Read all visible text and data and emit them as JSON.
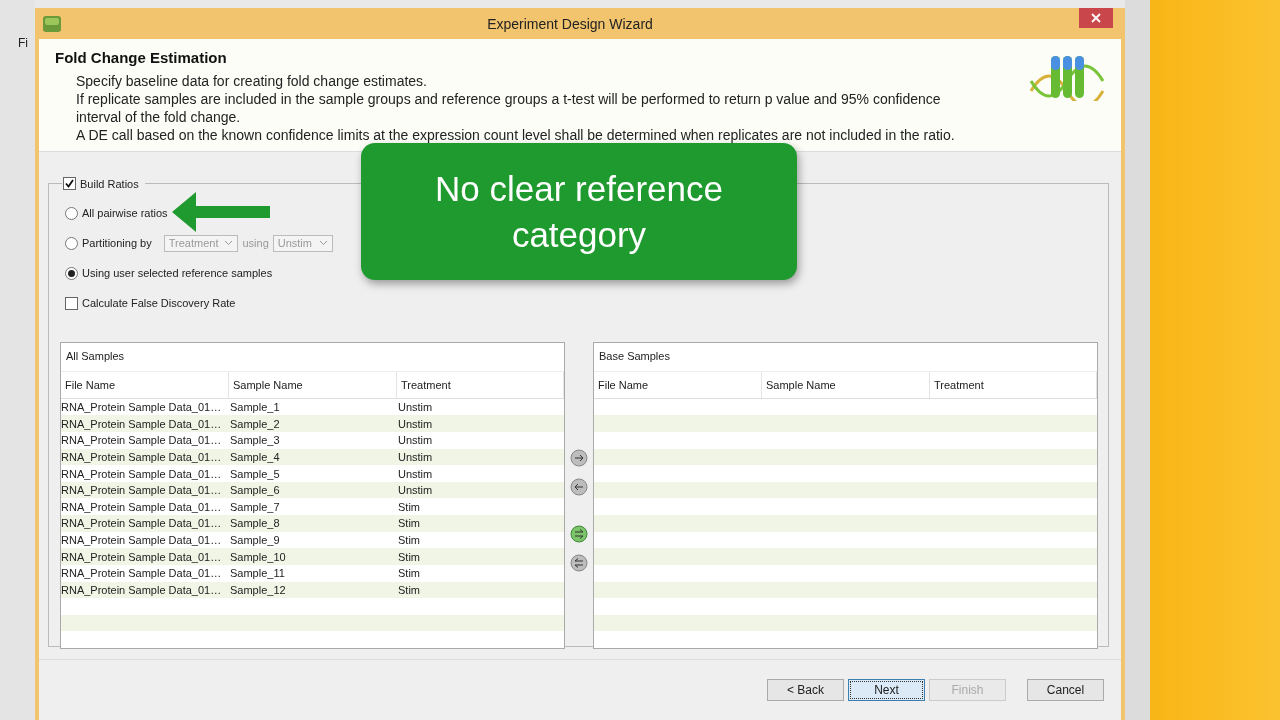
{
  "window": {
    "title": "Experiment Design Wizard"
  },
  "background_menu": "Fi",
  "header": {
    "title": "Fold Change Estimation",
    "lines": [
      "Specify baseline data for creating fold change estimates.",
      "If replicate samples are included in the sample groups and reference groups a t-test will be performed to return p value and 95% confidence",
      "interval of the fold change.",
      "A DE call based on the known confidence limits at the expression count level shall be determined when replicates are not included in the ratio."
    ]
  },
  "build_ratios": {
    "label": "Build Ratios",
    "checked": true
  },
  "options": [
    {
      "kind": "radio",
      "label": "All pairwise ratios",
      "selected": false
    },
    {
      "kind": "partition",
      "label": "Partitioning by",
      "selected": false,
      "combo1": "Treatment",
      "joiner": "using",
      "combo2": "Unstim"
    },
    {
      "kind": "radio",
      "label": "Using user selected reference samples",
      "selected": true
    }
  ],
  "fdr": {
    "label": "Calculate False Discovery Rate",
    "checked": false
  },
  "tables": [
    {
      "title": "All Samples",
      "columns": [
        "File Name",
        "Sample Name",
        "Treatment"
      ],
      "rows": [
        [
          "RNA_Protein Sample Data_01…",
          "Sample_1",
          "Unstim"
        ],
        [
          "RNA_Protein Sample Data_01…",
          "Sample_2",
          "Unstim"
        ],
        [
          "RNA_Protein Sample Data_01…",
          "Sample_3",
          "Unstim"
        ],
        [
          "RNA_Protein Sample Data_01…",
          "Sample_4",
          "Unstim"
        ],
        [
          "RNA_Protein Sample Data_01…",
          "Sample_5",
          "Unstim"
        ],
        [
          "RNA_Protein Sample Data_01…",
          "Sample_6",
          "Unstim"
        ],
        [
          "RNA_Protein Sample Data_01…",
          "Sample_7",
          "Stim"
        ],
        [
          "RNA_Protein Sample Data_01…",
          "Sample_8",
          "Stim"
        ],
        [
          "RNA_Protein Sample Data_01…",
          "Sample_9",
          "Stim"
        ],
        [
          "RNA_Protein Sample Data_01…",
          "Sample_10",
          "Stim"
        ],
        [
          "RNA_Protein Sample Data_01…",
          "Sample_11",
          "Stim"
        ],
        [
          "RNA_Protein Sample Data_01…",
          "Sample_12",
          "Stim"
        ]
      ]
    },
    {
      "title": "Base Samples",
      "columns": [
        "File Name",
        "Sample Name",
        "Treatment"
      ]
    }
  ],
  "transfer_buttons": [
    {
      "kind": "add",
      "highlighted": false
    },
    {
      "kind": "remove",
      "highlighted": false
    },
    {
      "kind": "add_all",
      "highlighted": true
    },
    {
      "kind": "remove_all",
      "highlighted": false
    }
  ],
  "buttons": [
    {
      "label": "< Back",
      "disabled": false,
      "focused": false
    },
    {
      "label": "Next",
      "disabled": false,
      "focused": true
    },
    {
      "label": "Finish",
      "disabled": true,
      "focused": false
    },
    {
      "label": "Cancel",
      "disabled": false,
      "focused": false
    }
  ],
  "callout": {
    "text": "No clear reference category"
  }
}
